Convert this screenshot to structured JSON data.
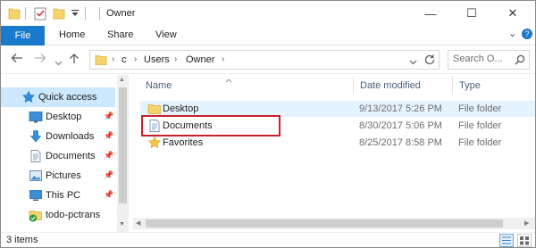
{
  "window": {
    "title": "Owner",
    "controls": {
      "minimize": "—",
      "maximize": "☐",
      "close": "✕"
    }
  },
  "ribbon": {
    "tabs": [
      "File",
      "Home",
      "Share",
      "View"
    ],
    "expand_glyph": "⌄",
    "help_glyph": "?"
  },
  "address": {
    "path": [
      "c",
      "Users",
      "Owner"
    ],
    "search_placeholder": "Search O..."
  },
  "nav_pane": {
    "items": [
      {
        "label": "Quick access",
        "icon": "star-icon",
        "selected": true,
        "pinned": false
      },
      {
        "label": "Desktop",
        "icon": "desktop-folder-icon",
        "pinned": true
      },
      {
        "label": "Downloads",
        "icon": "download-arrow-icon",
        "pinned": true
      },
      {
        "label": "Documents",
        "icon": "document-icon",
        "pinned": true
      },
      {
        "label": "Pictures",
        "icon": "pictures-icon",
        "pinned": true
      },
      {
        "label": "This PC",
        "icon": "computer-icon",
        "pinned": true
      },
      {
        "label": "todo-pctrans",
        "icon": "synced-folder-icon",
        "pinned": false
      }
    ]
  },
  "columns": [
    "Name",
    "Date modified",
    "Type"
  ],
  "files": [
    {
      "name": "Desktop",
      "date": "9/13/2017 5:26 PM",
      "type": "File folder",
      "icon": "folder-icon",
      "hovered": true
    },
    {
      "name": "Documents",
      "date": "8/30/2017 5:06 PM",
      "type": "File folder",
      "icon": "document-icon",
      "highlighted": true
    },
    {
      "name": "Favorites",
      "date": "8/25/2017 8:58 PM",
      "type": "File folder",
      "icon": "star-icon"
    }
  ],
  "status": {
    "item_count": "3 items"
  },
  "colors": {
    "accent": "#1979ca",
    "selection": "#cce8ff",
    "hover": "#e5f3ff",
    "highlight_border": "#c8202f",
    "folder": "#f6d36b"
  }
}
